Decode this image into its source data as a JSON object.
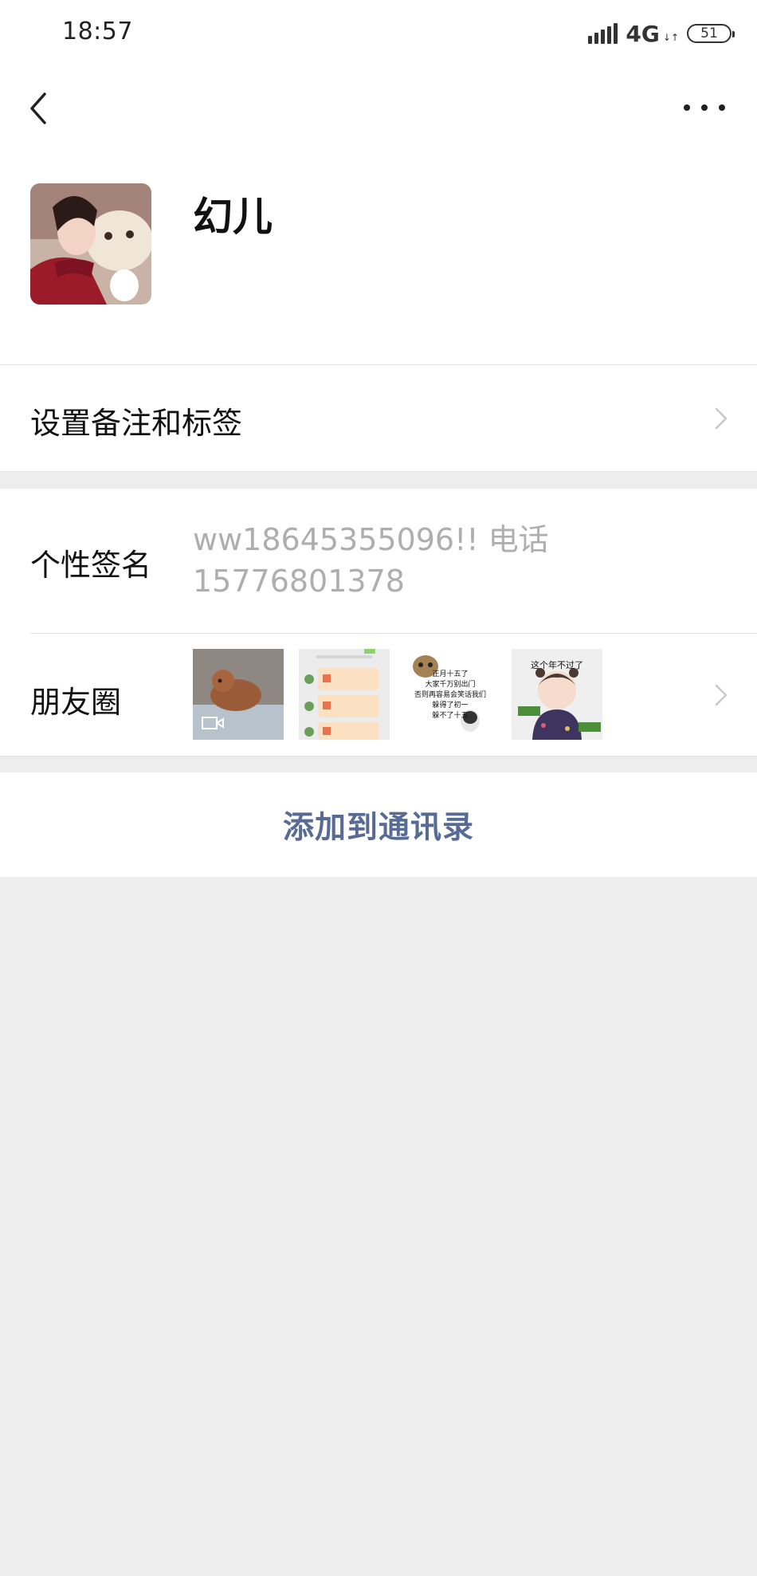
{
  "status_bar": {
    "time": "18:57",
    "network": "4G",
    "battery": "51"
  },
  "header": {
    "back_icon": "chevron-left-icon",
    "more_icon": "more-dots-icon"
  },
  "profile": {
    "name": "幻儿",
    "avatar": "profile-avatar-photo"
  },
  "remark_row": {
    "label": "设置备注和标签"
  },
  "signature_row": {
    "label": "个性签名",
    "value": "ww18645355096!! 电话 15776801378"
  },
  "moments_row": {
    "label": "朋友圈",
    "thumbnails": [
      {
        "kind": "video",
        "desc": "dog-photo"
      },
      {
        "kind": "image",
        "desc": "chat-screenshot"
      },
      {
        "kind": "image",
        "text": "正月十五了\n大家千万别出门\n否则再容易会笑话我们\n躲得了初一\n躲不了十五"
      },
      {
        "kind": "image",
        "text": "这个年不过了"
      }
    ]
  },
  "add_button": {
    "label": "添加到通讯录"
  },
  "colors": {
    "link_blue": "#576b95",
    "page_bg": "#ededed",
    "secondary_text": "#aeaeae"
  }
}
